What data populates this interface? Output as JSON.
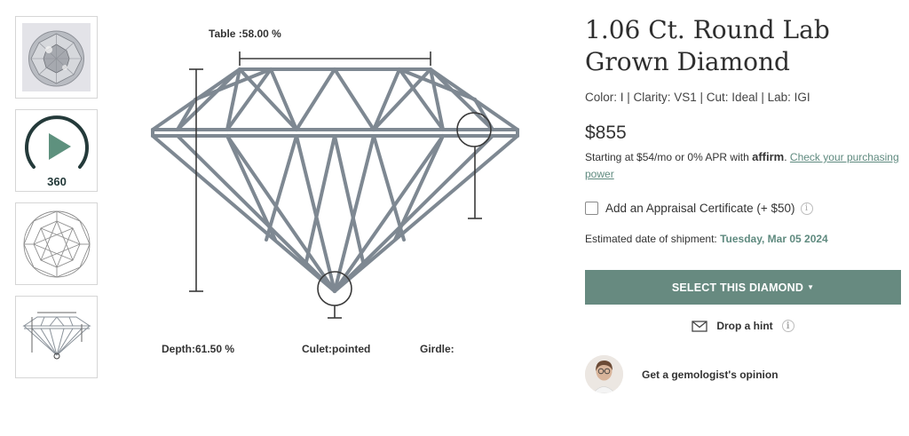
{
  "gallery": {
    "thumbnails": [
      {
        "kind": "photo",
        "selected": false
      },
      {
        "kind": "video-360",
        "label": "360"
      },
      {
        "kind": "top-outline",
        "selected": false
      },
      {
        "kind": "profile-diagram",
        "selected": true
      }
    ]
  },
  "diagram": {
    "table_label": "Table :58.00 %",
    "depth_label": "Depth:61.50 %",
    "culet_label": "Culet:pointed",
    "girdle_label": "Girdle:",
    "line_color": "#7e8892"
  },
  "product": {
    "title": "1.06 Ct. Round Lab Grown Diamond",
    "specs": "Color: I | Clarity: VS1 | Cut: Ideal | Lab: IGI",
    "price": "$855",
    "financing_text": "Starting at $54/mo or 0% APR with",
    "affirm_brand": "affirm",
    "financing_link": "Check your purchasing power",
    "appraisal_label": "Add an Appraisal Certificate (+ $50)",
    "shipment_label": "Estimated date of shipment:",
    "shipment_date": "Tuesday, Mar 05 2024",
    "select_button": "SELECT THIS DIAMOND",
    "hint_label": "Drop a hint",
    "gemologist_label": "Get a gemologist's opinion",
    "accent_color": "#678a80",
    "link_color": "#5f8a7f"
  }
}
